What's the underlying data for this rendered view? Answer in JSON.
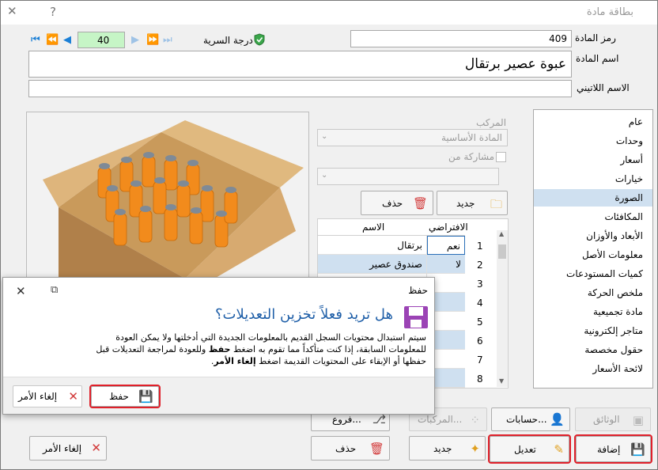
{
  "window": {
    "title": "بطاقة مادة",
    "help": "?",
    "close": "✕"
  },
  "record_nav": {
    "current": "40",
    "secrecy_label": "درجة السرية"
  },
  "fields": {
    "code_label": "رمز المادة",
    "code_value": "409",
    "name_label": "اسم المادة",
    "name_value": "عبوة عصير برتقال",
    "latin_label": "الاسم اللاتيني",
    "latin_value": ""
  },
  "sidebar": {
    "items": [
      {
        "label": "عام"
      },
      {
        "label": "وحدات"
      },
      {
        "label": "أسعار"
      },
      {
        "label": "خيارات"
      },
      {
        "label": "الصورة",
        "selected": true
      },
      {
        "label": "المكافئات"
      },
      {
        "label": "الأبعاد والأوزان"
      },
      {
        "label": "معلومات الأصل"
      },
      {
        "label": "كميات المستودعات"
      },
      {
        "label": "ملخص الحركة"
      },
      {
        "label": "مادة تجميعية"
      },
      {
        "label": "متاجر إلكترونية"
      },
      {
        "label": "حقول مخصصة"
      },
      {
        "label": "لائحة الأسعار"
      }
    ]
  },
  "composite": {
    "label": "المركب",
    "select_value": "المادة الأساسية",
    "share_label": "مشاركة من",
    "new_label": "جديد",
    "delete_label": "حذف",
    "col_default": "الافتراضي",
    "col_name": "الاسم",
    "rows": [
      {
        "num": "1",
        "default": "نعم",
        "name": "برتقال"
      },
      {
        "num": "2",
        "default": "لا",
        "name": "صندوق عصير"
      },
      {
        "num": "3",
        "default": "",
        "name": ""
      },
      {
        "num": "4",
        "default": "",
        "name": ""
      },
      {
        "num": "5",
        "default": "",
        "name": ""
      },
      {
        "num": "6",
        "default": "",
        "name": ""
      },
      {
        "num": "7",
        "default": "",
        "name": ""
      },
      {
        "num": "8",
        "default": "",
        "name": ""
      }
    ]
  },
  "bottom": {
    "documents": "الوثائق",
    "accounts": "حسابات...",
    "composites": "المركبات...",
    "branches": "فروع...",
    "add": "إضافة",
    "edit": "تعديل",
    "new": "جديد",
    "delete": "حذف",
    "cancel": "إلغاء الأمر"
  },
  "dialog": {
    "title": "حفظ",
    "heading": "هل تريد فعلاً تخزين التعديلات؟",
    "body_line1": "سيتم استبدال محتويات السجل القديم بالمعلومات الجديدة التي أدخلتها ولا يمكن العودة",
    "body_line2_a": "للمعلومات السابقة، إذا كنت متأكداً مما تقوم به اضغط ",
    "body_line2_b": "حفظ",
    "body_line2_c": " وللعودة لمراجعة التعديلات قبل",
    "body_line3_a": "حفظها أو الإبقاء على المحتويات القديمة اضغط ",
    "body_line3_b": "إلغاء الأمر",
    "body_line3_c": ".",
    "save_label": "حفظ",
    "cancel_label": "إلغاء الأمر"
  },
  "colors": {
    "accent_red": "#e0202a",
    "selection": "#cfe0f0",
    "nav_blue": "#1b7fd6",
    "dialog_heading": "#1f5fa8"
  }
}
